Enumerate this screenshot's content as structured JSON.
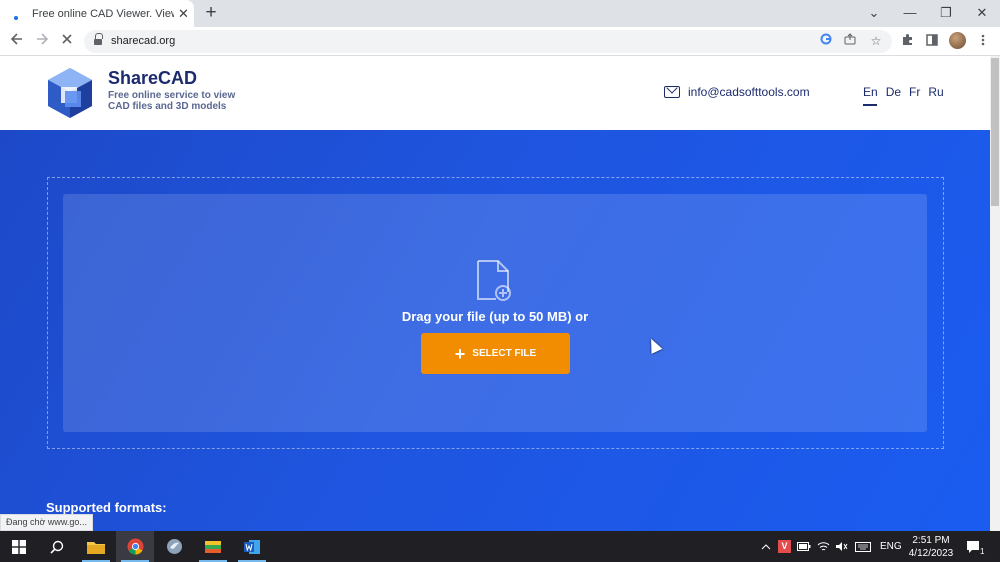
{
  "browser": {
    "tab_title": "Free online CAD Viewer. View Au",
    "tab_close": "✕",
    "new_tab": "+",
    "url": "sharecad.org",
    "window_controls": {
      "minimize": "—",
      "restore": "❐",
      "close": "✕",
      "tab_search": "⌄"
    }
  },
  "site": {
    "brand_name": "ShareCAD",
    "tagline": "Free online service to view CAD files and 3D models",
    "email": "info@cadsofttools.com",
    "languages": [
      "En",
      "De",
      "Fr",
      "Ru"
    ],
    "active_language": "En"
  },
  "hero": {
    "drag_text": "Drag your file (up to 50 MB) or",
    "select_button": "SELECT FILE",
    "supported_formats": "Supported formats:"
  },
  "status_tooltip": "Đang chờ www.go...",
  "taskbar": {
    "apps": [
      "start",
      "search",
      "file-explorer",
      "chrome",
      "app-bird",
      "app-stack",
      "word"
    ],
    "tray_language": "ENG",
    "time": "2:51 PM",
    "date": "4/12/2023",
    "notification_count": "1"
  },
  "colors": {
    "brand_navy": "#1b2b6e",
    "hero_blue": "#1f55e0",
    "select_orange": "#f28c00"
  }
}
